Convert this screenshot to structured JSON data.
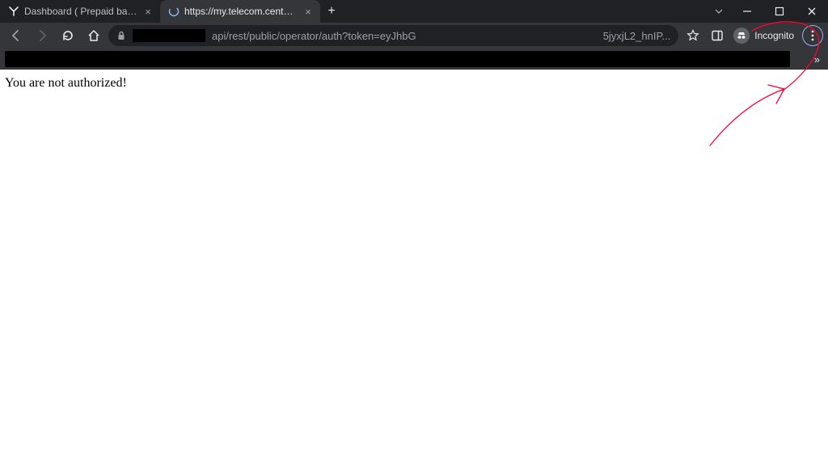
{
  "window": {
    "tabs": [
      {
        "title": "Dashboard ( Prepaid balance )",
        "active": false,
        "favicon": "y-icon"
      },
      {
        "title": "https://my.telecom.center/api/re",
        "active": true,
        "favicon": "spinner-icon"
      }
    ]
  },
  "toolbar": {
    "url_visible_left": "api/rest/public/operator/auth?token=eyJhbG",
    "url_visible_right": "5jyxjL2_hnIP...",
    "incognito_label": "Incognito"
  },
  "page": {
    "body_text": "You are not authorized!"
  },
  "annotation": {
    "color": "#ff0033"
  }
}
